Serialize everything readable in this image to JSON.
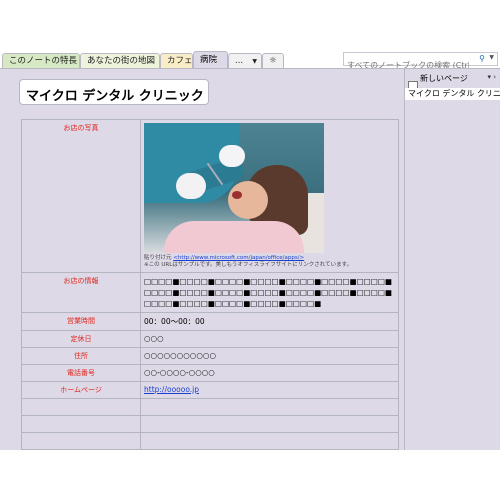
{
  "tabs": [
    {
      "label": "このノートの特長"
    },
    {
      "label": "あなたの街の地図"
    },
    {
      "label": "カフェ"
    },
    {
      "label": "病院"
    },
    {
      "label": "..."
    },
    {
      "label": "☼"
    }
  ],
  "search": {
    "placeholder": "すべてのノートブックの検索 (Ctrl+E)",
    "icon": "search-icon"
  },
  "page": {
    "title": "マイクロ デンタル クリニック",
    "rows": [
      {
        "label": "お店の写真"
      },
      {
        "label": "お店の情報",
        "value": "□□□□■□□□□■□□□□■□□□□■□□□□■□□□□■□□□□■□□□□■□□□□■□□□□■□□□□■□□□□■□□□□■□□□□■□□□□■□□□□■□□□□■□□□□■□□□□■"
      },
      {
        "label": "営業時間",
        "value": "00：00～00：00"
      },
      {
        "label": "定休日",
        "value": "○○○"
      },
      {
        "label": "住所",
        "value": "○○○○○○○○○○○"
      },
      {
        "label": "電話番号",
        "value": "○○-○○○○-○○○○"
      },
      {
        "label": "ホームページ",
        "value": "http://ooooo.jp"
      }
    ],
    "photo_caption": {
      "prefix": "貼り付け元",
      "link": "<http://www.microsoft.com/japan/office/apps/>",
      "note": "※この URLはサンプルです。美しもうオフィスライフサイトにリンクされています。"
    }
  },
  "right_pane": {
    "new_page_label": "新しいページ",
    "controls": "▾ ›",
    "pages": [
      "マイクロ デンタル クリニック"
    ]
  }
}
